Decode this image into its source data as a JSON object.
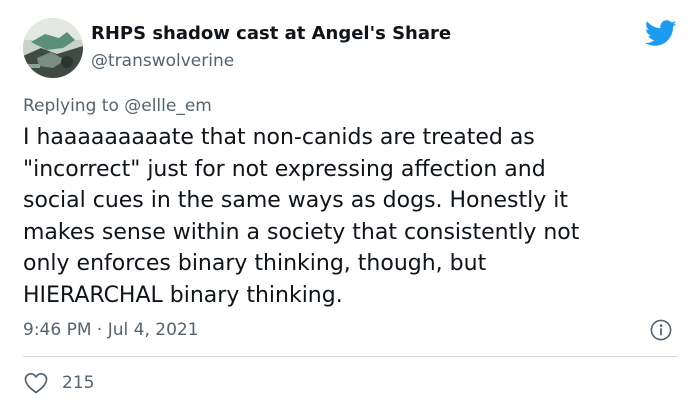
{
  "author": {
    "display_name": "RHPS shadow cast at Angel's Share",
    "handle": "@transwolverine",
    "avatar_icon": "avatar-image"
  },
  "reply": {
    "prefix": "Replying to ",
    "mention": "@ellle_em"
  },
  "tweet": {
    "text": "I haaaaaaaaate that non-canids are treated as\n\"incorrect\" just for not expressing affection and\nsocial cues in the same ways as dogs. Honestly it\nmakes sense within a society that consistently not\nonly enforces binary thinking, though, but\nHIERARCHAL binary thinking.",
    "timestamp": "9:46 PM · Jul 4, 2021"
  },
  "stats": {
    "likes": "215"
  },
  "icons": {
    "brand": "twitter-bird-icon",
    "info": "info-icon",
    "like": "heart-icon"
  },
  "colors": {
    "brand": "#1d9bf0",
    "text": "#0f1419",
    "secondary": "#536471",
    "divider": "#cfd9de"
  }
}
